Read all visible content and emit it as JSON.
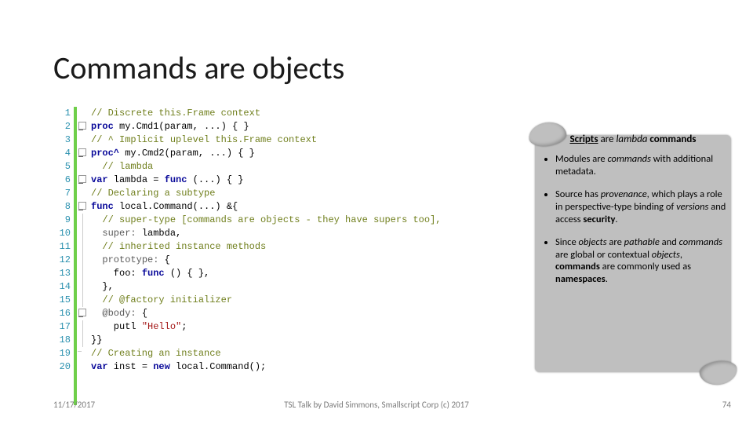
{
  "title": "Commands are objects",
  "code": {
    "lines": [
      {
        "n": "1",
        "fold": "",
        "html": "<span class='cm'>// Discrete this.Frame context</span>"
      },
      {
        "n": "2",
        "fold": "minus",
        "html": "<span class='kw'>proc</span> my.Cmd1(param, ...) { }"
      },
      {
        "n": "3",
        "fold": "",
        "html": "<span class='cm'>// ^ Implicit uplevel this.Frame context</span>"
      },
      {
        "n": "4",
        "fold": "minus",
        "html": "<span class='kw'>proc^</span> my.Cmd2(param, ...) { }"
      },
      {
        "n": "5",
        "fold": "",
        "html": "  <span class='cm'>// lambda</span>"
      },
      {
        "n": "6",
        "fold": "minus",
        "html": "<span class='kw'>var</span> lambda = <span class='kw'>func</span> (...) { }"
      },
      {
        "n": "7",
        "fold": "",
        "html": "<span class='cm'>// Declaring a subtype</span>"
      },
      {
        "n": "8",
        "fold": "minus",
        "html": "<span class='kw'>func</span> local.Command(...) &amp;{"
      },
      {
        "n": "9",
        "fold": "bar",
        "html": "  <span class='cm'>// super-type [commands are objects - they have supers too],</span>"
      },
      {
        "n": "10",
        "fold": "bar",
        "html": "  <span class='bi'>super:</span> lambda,"
      },
      {
        "n": "11",
        "fold": "bar",
        "html": "  <span class='cm'>// inherited instance methods</span>"
      },
      {
        "n": "12",
        "fold": "bar",
        "html": "  <span class='bi'>prototype:</span> {"
      },
      {
        "n": "13",
        "fold": "bar",
        "html": "    foo: <span class='kw'>func</span> () { },"
      },
      {
        "n": "14",
        "fold": "bar",
        "html": "  },"
      },
      {
        "n": "15",
        "fold": "bar",
        "html": "  <span class='cm'>// @factory initializer</span>"
      },
      {
        "n": "16",
        "fold": "minus",
        "html": "  <span class='bi'>@body:</span> {"
      },
      {
        "n": "17",
        "fold": "bar",
        "html": "    putl <span class='str'>\"Hello\"</span>;"
      },
      {
        "n": "18",
        "fold": "end",
        "html": "}}"
      },
      {
        "n": "19",
        "fold": "",
        "html": "<span class='cm'>// Creating an instance</span>"
      },
      {
        "n": "20",
        "fold": "",
        "html": "<span class='kw'>var</span> inst = <span class='kw'>new</span> local.Command();"
      }
    ]
  },
  "callout": {
    "headline": "Scripts are lambda commands",
    "bullets": [
      "Modules are commands with additional metadata.",
      "Source has provenance, which plays a role in perspective-type binding of versions and access security.",
      "Since objects are pathable and commands are global or contextual objects, commands are commonly used as namespaces."
    ]
  },
  "footer": {
    "date": "11/17/2017",
    "center": "TSL Talk by David Simmons, Smallscript Corp (c) 2017",
    "page": "74"
  }
}
